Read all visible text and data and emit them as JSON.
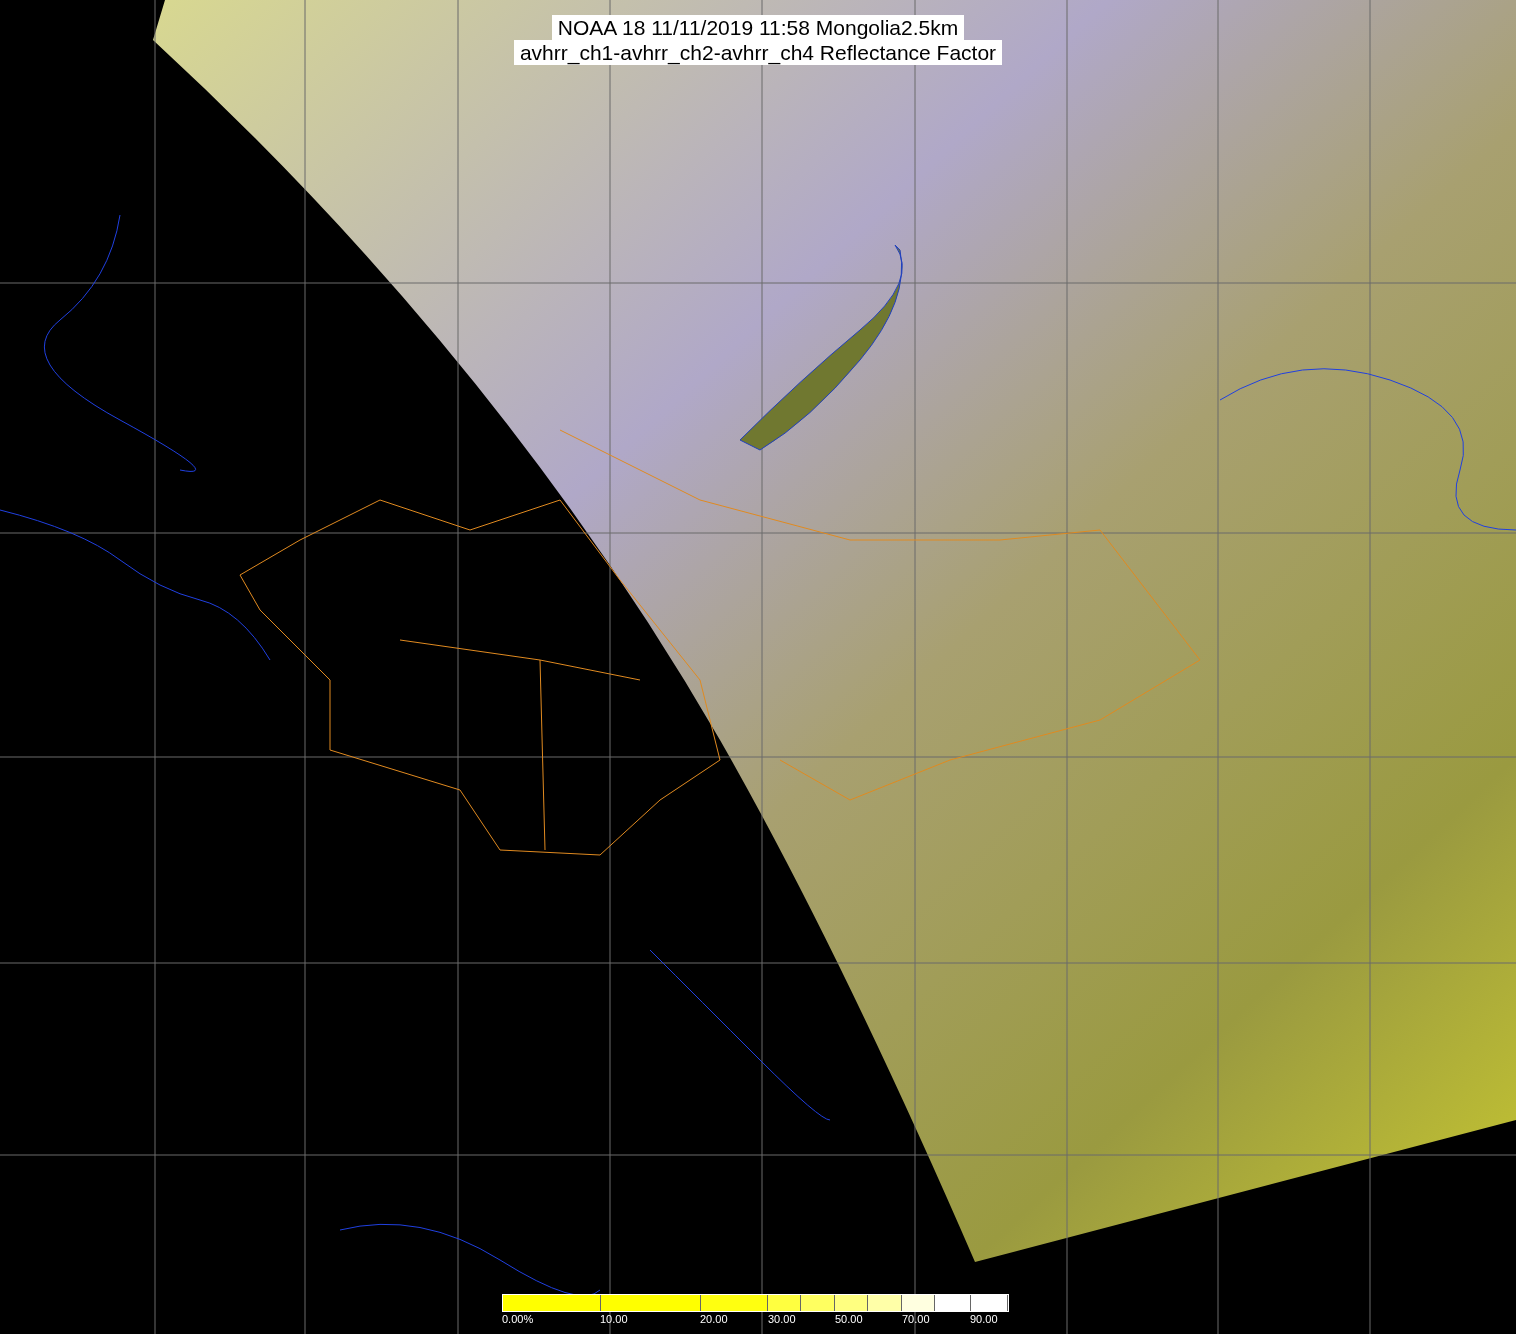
{
  "title": {
    "line_1": "NOAA 18 11/11/2019 11:58 Mongolia2.5km",
    "line_2": "avhrr_ch1-avhrr_ch2-avhrr_ch4 Reflectance Factor"
  },
  "colorbar": {
    "labels": [
      "0.00%",
      "10.00",
      "20.00",
      "30.00",
      "50.00",
      "70.00",
      "90.00"
    ]
  }
}
